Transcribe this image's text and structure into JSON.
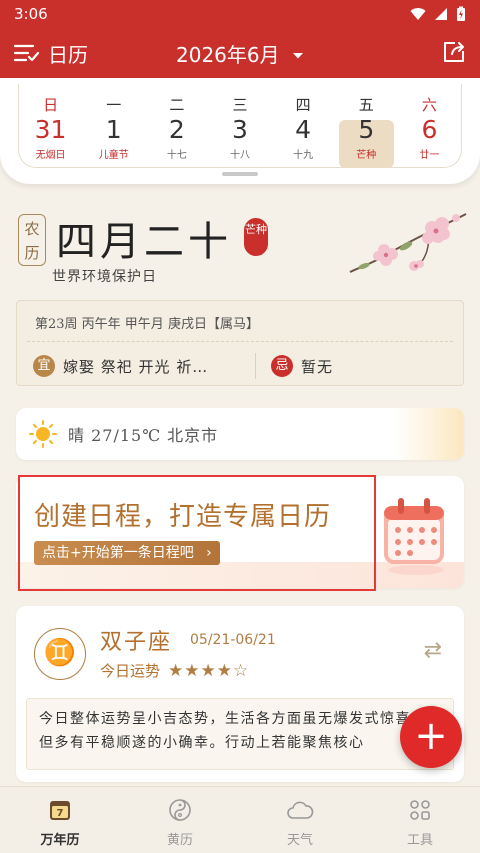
{
  "status_bar": {
    "time": "3:06"
  },
  "app_bar": {
    "title": "日历",
    "month": "2026年6月"
  },
  "week": {
    "days": [
      {
        "weekday": "日",
        "date": "31",
        "sub": "无烟日"
      },
      {
        "weekday": "一",
        "date": "1",
        "sub": "儿童节"
      },
      {
        "weekday": "二",
        "date": "2",
        "sub": "十七"
      },
      {
        "weekday": "三",
        "date": "3",
        "sub": "十八"
      },
      {
        "weekday": "四",
        "date": "4",
        "sub": "十九"
      },
      {
        "weekday": "五",
        "date": "5",
        "sub": "芒种"
      },
      {
        "weekday": "六",
        "date": "6",
        "sub": "廿一"
      }
    ]
  },
  "lunar": {
    "tag": "农历",
    "date": "四月二十",
    "jieqi": "芒种",
    "festival": "世界环境保护日",
    "ganzhi": "第23周 丙午年 甲午月 庚戌日【属马】",
    "yi_label": "宜",
    "yi_text": "嫁娶 祭祀 开光 祈…",
    "ji_label": "忌",
    "ji_text": "暂无"
  },
  "weather": {
    "text": "晴 27/15℃ 北京市"
  },
  "promo": {
    "title": "创建日程，打造专属日历",
    "button": "点击+开始第一条日程吧"
  },
  "horoscope": {
    "symbol": "♊",
    "name": "双子座",
    "range": "05/21-06/21",
    "fortune_label": "今日运势",
    "stars": "★★★★☆",
    "rating": 4,
    "text": "今日整体运势呈小吉态势，生活各方面虽无爆发式惊喜，但多有平稳顺遂的小确幸。行动上若能聚焦核心"
  },
  "fab": {
    "label": "+"
  },
  "bottom_nav": [
    {
      "label": "万年历",
      "icon": "calendar-icon"
    },
    {
      "label": "黄历",
      "icon": "yin-yang-icon"
    },
    {
      "label": "天气",
      "icon": "cloud-icon"
    },
    {
      "label": "工具",
      "icon": "tools-icon"
    }
  ],
  "colors": {
    "primary": "#c9302c",
    "accent": "#b3702f",
    "highlight": "#e53935"
  }
}
